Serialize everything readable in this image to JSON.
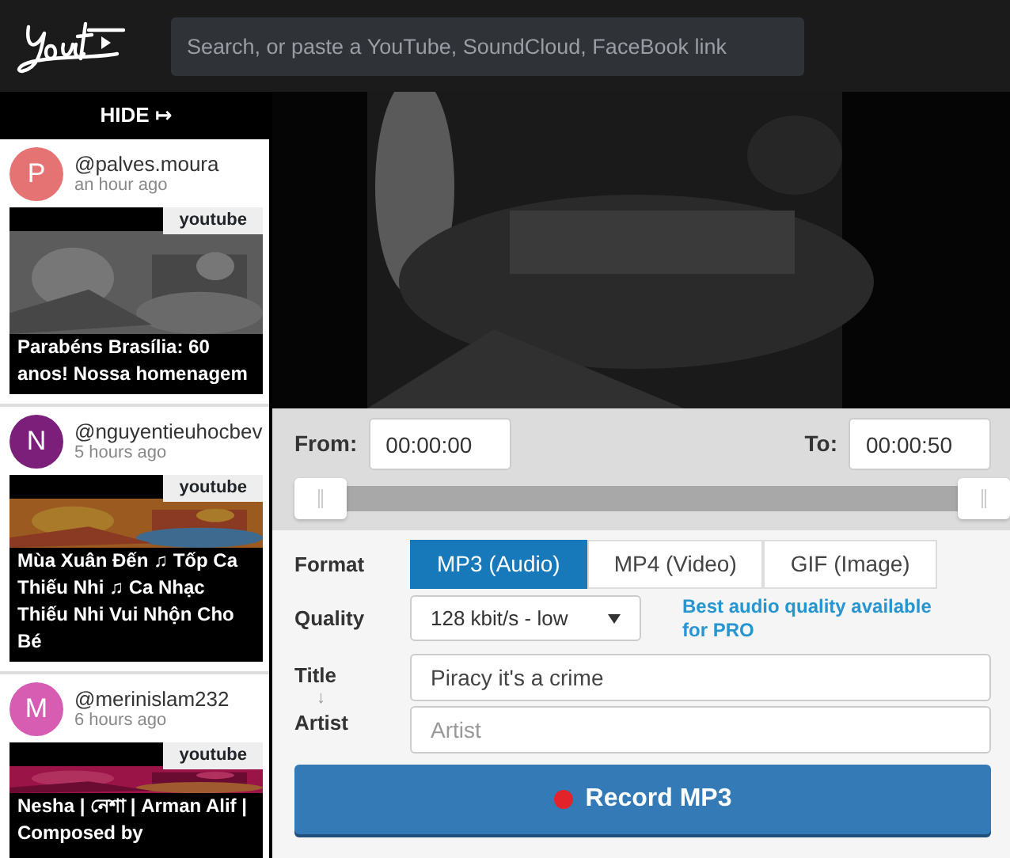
{
  "header": {
    "search_placeholder": "Search, or paste a YouTube, SoundCloud, FaceBook link"
  },
  "sidebar": {
    "hide_label": "HIDE ↦",
    "items": [
      {
        "avatar_letter": "P",
        "color": "#e57373",
        "user": "@palves.moura",
        "time": "an hour ago",
        "source": "youtube",
        "title": "Parabéns Brasília: 60 anos! Nossa homenagem"
      },
      {
        "avatar_letter": "N",
        "color": "#7b1f7a",
        "user": "@nguyentieuhocbev",
        "time": "5 hours ago",
        "source": "youtube",
        "title": "Mùa Xuân Đến ♫ Tốp Ca Thiếu Nhi ♫ Ca Nhạc Thiếu Nhi Vui Nhộn Cho Bé"
      },
      {
        "avatar_letter": "M",
        "color": "#d65db1",
        "user": "@merinislam232",
        "time": "6 hours ago",
        "source": "youtube",
        "title": "Nesha | নেশা | Arman Alif | Composed by"
      }
    ]
  },
  "trim": {
    "from_label": "From:",
    "from_value": "00:00:00",
    "to_label": "To:",
    "to_value": "00:00:50",
    "handles": [
      {
        "level": 0
      },
      {
        "level": 1
      }
    ]
  },
  "form": {
    "format_label": "Format",
    "formats": [
      {
        "label": "MP3 (Audio)",
        "selected": true
      },
      {
        "label": "MP4 (Video)",
        "selected": false
      },
      {
        "label": "GIF (Image)",
        "selected": false
      }
    ],
    "quality_label": "Quality",
    "quality_value": "128 kbit/s - low",
    "pro_note": "Best audio quality available for PRO",
    "title_label": "Title",
    "swap_arrow": "↓",
    "artist_label": "Artist",
    "title_value": "Piracy it's a crime",
    "artist_placeholder": "Artist",
    "record_label": "Record MP3"
  }
}
